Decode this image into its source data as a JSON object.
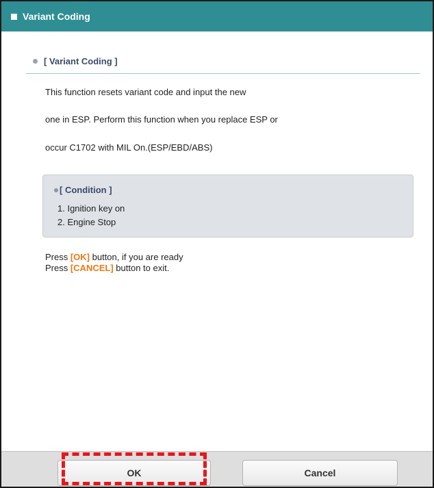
{
  "window": {
    "title": "Variant Coding"
  },
  "section": {
    "heading": "[ Variant Coding ]"
  },
  "description": [
    "This function resets variant code and input the new",
    "one in ESP. Perform this function when you replace ESP or",
    "occur C1702 with MIL On.(ESP/EBD/ABS)"
  ],
  "condition": {
    "title": "[ Condition ]",
    "items": [
      "1. Ignition key on",
      "2. Engine Stop"
    ]
  },
  "instructions": {
    "ok": {
      "prefix": "Press ",
      "key": "[OK]",
      "suffix": " button, if you are ready"
    },
    "cancel": {
      "prefix": "Press ",
      "key": "[CANCEL]",
      "suffix": " button to exit."
    }
  },
  "buttons": {
    "ok_label": "OK",
    "cancel_label": "Cancel"
  },
  "colors": {
    "titlebar": "#2f8e94",
    "key_highlight": "#ea7a14",
    "annotation": "#e8161c"
  }
}
